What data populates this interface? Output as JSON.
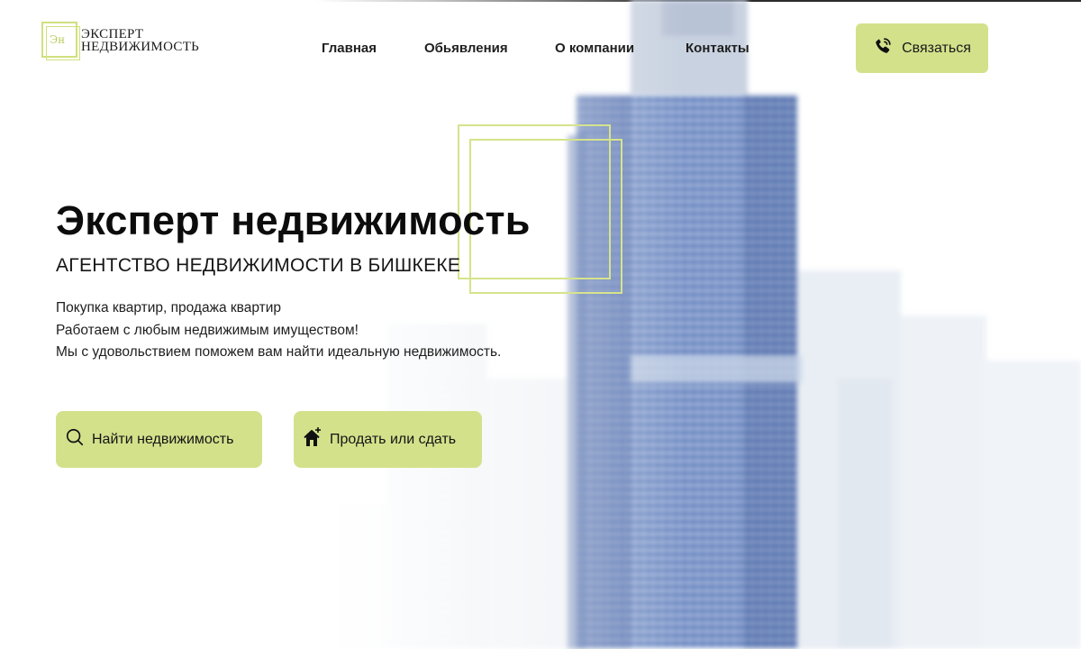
{
  "header": {
    "logo": {
      "mark": "Эн",
      "line1": "ЭКСПЕРТ",
      "line2": "НЕДВИЖИМОСТЬ"
    },
    "nav": [
      {
        "label": "Главная"
      },
      {
        "label": "Обьявления"
      },
      {
        "label": "О компании"
      },
      {
        "label": "Контакты"
      }
    ],
    "contact_button": {
      "label": "Связаться",
      "icon": "phone-icon"
    }
  },
  "hero": {
    "title": "Эксперт недвижимость",
    "subtitle": "АГЕНТСТВО НЕДВИЖИМОСТИ В БИШКЕКЕ",
    "description": [
      "Покупка квартир, продажа квартир",
      "Работаем с любым недвижимым имуществом!",
      "Мы с удовольствием поможем вам найти идеальную недвижимость."
    ],
    "buttons": [
      {
        "label": "Найти недвижимость",
        "icon": "search-icon"
      },
      {
        "label": "Продать или сдать",
        "icon": "house-plus-icon"
      }
    ]
  },
  "colors": {
    "accent": "#d4e18b",
    "frame": "#d6e38c",
    "text": "#111111",
    "tower_glass": "#5b79b8"
  }
}
